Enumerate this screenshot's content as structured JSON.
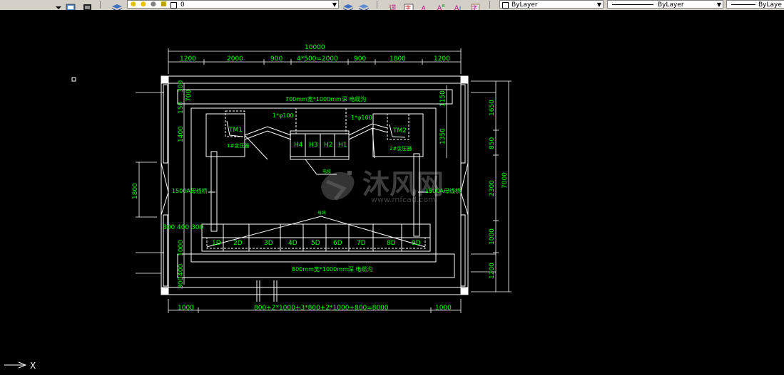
{
  "toolbar": {
    "layer_current": "0",
    "color_label": "ByLayer",
    "linetype_label": "ByLayer",
    "lineweight_label": "ByLaye",
    "icons": [
      "layer-manager-icon",
      "lightbulb-icon",
      "sun-icon",
      "freeze-icon",
      "lock-icon",
      "color-swatch-icon",
      "layer-previous-icon",
      "layer-states-icon",
      "text-style-icon",
      "dimension-style-icon",
      "table-style-icon",
      "multiline-text-icon",
      "multileader-style-icon"
    ]
  },
  "drawing": {
    "top_dims": [
      "10000",
      "1200",
      "2000",
      "900",
      "4*500=2000",
      "900",
      "1800",
      "1200"
    ],
    "bottom_dims": [
      "1000",
      "800+2*1000+3*800+2*1000+800=8000",
      "1000"
    ],
    "right_dims": [
      "7000",
      "1650",
      "850",
      "2300",
      "1000",
      "1200"
    ],
    "left_dims": [
      "1800",
      "700",
      "150",
      "1400",
      "300",
      "400",
      "300",
      "1000"
    ],
    "inner_right_dims": [
      "1150",
      "1350"
    ],
    "top_trench": "700mm宽*1000mm深 电缆沟",
    "bottom_trench": "800mm宽*1000mm深 电缆沟",
    "cable_left": "1*φ100",
    "cable_right": "1*φ100",
    "tm1": "TM1",
    "tm2": "TM2",
    "tm1_sub": "1#变压器",
    "tm2_sub": "2#变压器",
    "h_cabinets": [
      "H4",
      "H3",
      "H2",
      "H1"
    ],
    "d_cabinets": [
      "1D",
      "2D",
      "3D",
      "4D",
      "5D",
      "6D",
      "7D",
      "8D",
      "9D"
    ],
    "busbar_left": "1500A母线桥",
    "busbar_right": "1500A母线桥",
    "cable_label": "电缆",
    "busway_label": "母线",
    "dims_300_400_300": "300 400 300",
    "watermark_main": "沐风网",
    "watermark_url": "www.mfcad.com"
  },
  "ucs": {
    "x_label": "X"
  },
  "colors": {
    "background": "#000000",
    "dim": "#00ff00",
    "line": "#ffffff"
  }
}
